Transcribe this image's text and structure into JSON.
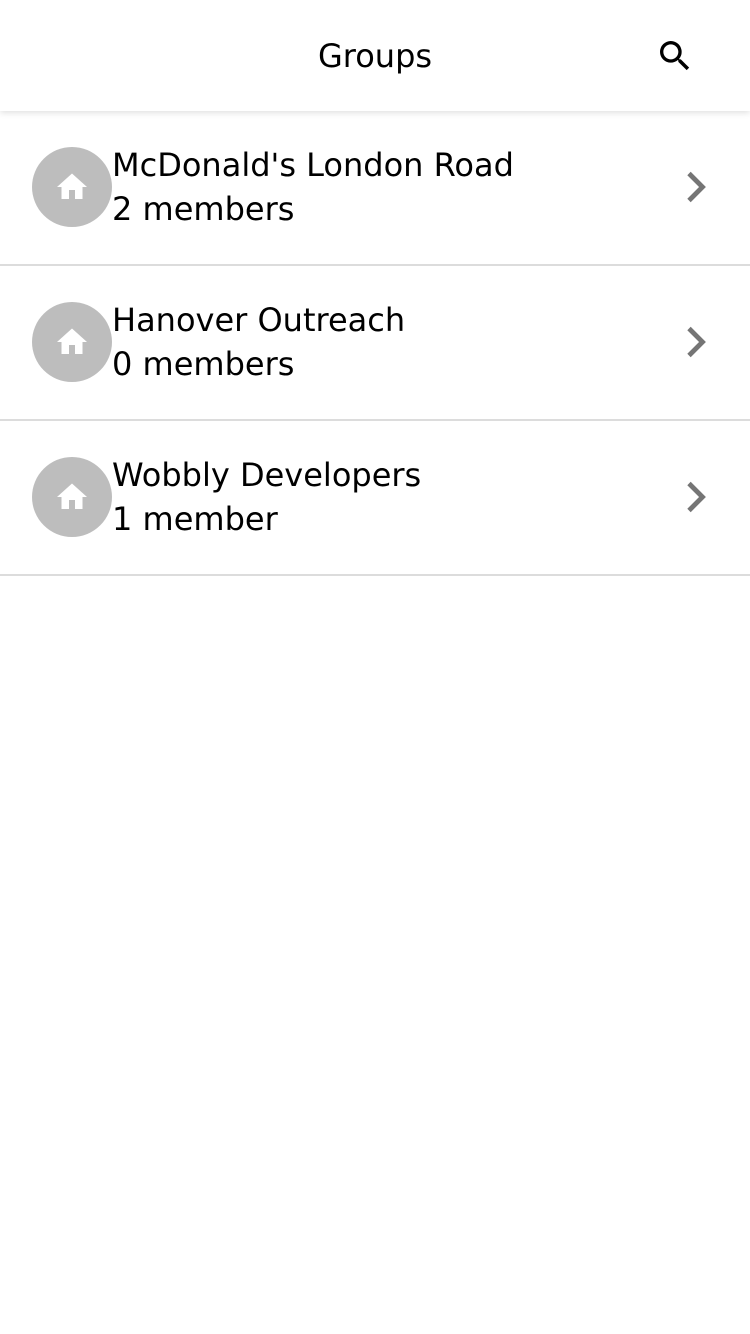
{
  "header": {
    "title": "Groups",
    "search_icon": "search-icon"
  },
  "groups": [
    {
      "name": "McDonald's London Road",
      "members": "2 members",
      "icon": "home-icon"
    },
    {
      "name": "Hanover Outreach",
      "members": "0 members",
      "icon": "home-icon"
    },
    {
      "name": "Wobbly Developers",
      "members": "1 member",
      "icon": "home-icon"
    }
  ],
  "colors": {
    "avatar_bg": "#bdbdbd",
    "divider": "#dcdcdc",
    "chevron": "#757575"
  }
}
